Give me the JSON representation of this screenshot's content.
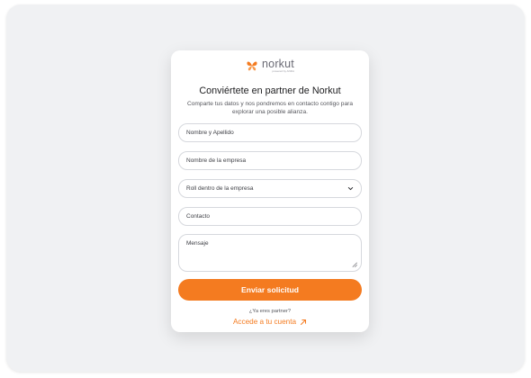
{
  "brand": {
    "name": "norkut",
    "sub": "powered by ANDA",
    "accent": "#f47b20"
  },
  "form": {
    "title": "Conviértete en partner de Norkut",
    "subtitle": "Comparte tus datos y nos pondremos en contacto contigo para explorar una posible alianza.",
    "fields": {
      "name": "Nombre y Apellido",
      "company": "Nombre de la empresa",
      "role": "Roll dentro de la empresa",
      "contact": "Contacto",
      "message": "Mensaje"
    },
    "submit_label": "Enviar solicitud",
    "partner_question": "¿Ya eres partner?",
    "login_link": "Accede a tu cuenta"
  },
  "icons": {
    "logo": "butterfly-logo-icon",
    "select": "chevron-down-icon",
    "resize": "resize-handle-icon",
    "link": "arrow-up-right-icon"
  }
}
